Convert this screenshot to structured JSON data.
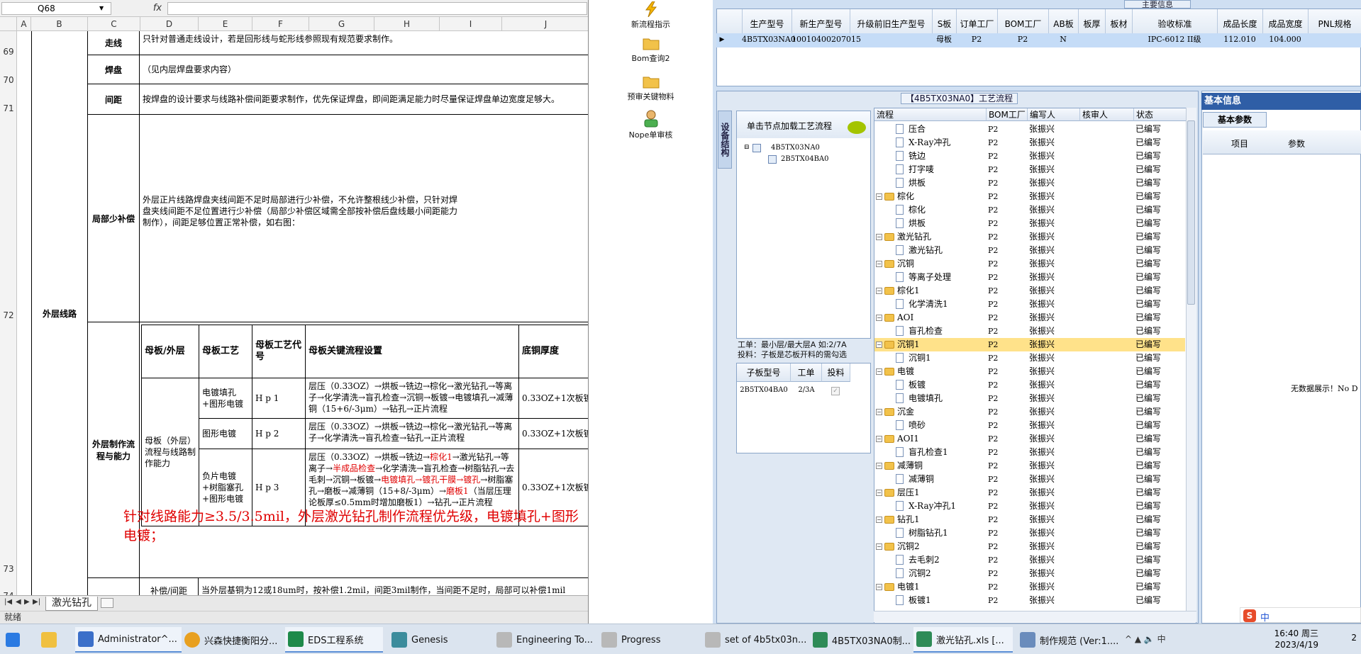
{
  "excel": {
    "name_box": "Q68",
    "fx": "fx",
    "columns": [
      "A",
      "B",
      "C",
      "D",
      "E",
      "F",
      "G",
      "H",
      "I",
      "J"
    ],
    "rows": [
      "69",
      "70",
      "71",
      "72",
      "73",
      "74"
    ],
    "labels": {
      "outer_line": "外层线路",
      "zouxian": "走线",
      "handpan": "焊盘",
      "jianju": "间距",
      "jubushao": "局部少补偿",
      "waiceng_zhizuo": "外层制作流程与能力",
      "buchang_jianju": "补偿/间距"
    },
    "texts": {
      "zouxian_text": "只针对普通走线设计，若是回形线与蛇形线参照现有规范要求制作。",
      "handpan_text": "（见内层焊盘要求内容）",
      "jianju_text": "按焊盘的设计要求与线路补偿间距要求制作，优先保证焊盘，即间距满足能力时尽量保证焊盘单边宽度足够大。",
      "jubushao_text": "外层正片线路焊盘夹线间距不足时局部进行少补偿，不允许整根线少补偿，只针对焊盘夹线间距不足位置进行少补偿（局部少补偿区域需全部按补偿后盘线最小间距能力制作），间距足够位置正常补偿，如右图：",
      "buchang_text": "当外层基铜为12或18um时，按补偿1.2mil，间距3mil制作，当间距不足时，局部可以补偿1mil"
    },
    "inner_table": {
      "headers": [
        "母板/外层",
        "母板工艺",
        "母板工艺代号",
        "母板关键流程设置",
        "底铜厚度"
      ],
      "mother_label": "母板（外层）流程与线路制作能力",
      "rows": [
        {
          "craft": "电镀填孔+图形电镀",
          "code": "H p 1",
          "flow": "层压（0.33OZ）→烘板→铣边→棕化→激光钻孔→等离子→化学清洗→盲孔检查→沉铜→板镀→电镀填孔→减薄铜（15+6/-3μm）→钻孔→正片流程",
          "copper": "0.33OZ+1次板镀"
        },
        {
          "craft": "图形电镀",
          "code": "H p 2",
          "flow": "层压（0.33OZ）→烘板→铣边→棕化→激光钻孔→等离子→化学清洗→盲孔检查→钻孔→正片流程",
          "copper": "0.33OZ+1次板镀"
        },
        {
          "craft": "负片电镀+树脂塞孔+图形电镀",
          "code": "H p 3",
          "flow_a": "层压（0.33OZ）→烘板→铣边→",
          "flow_r1": "棕化1",
          "flow_b": "→激光钻孔→等离子→",
          "flow_r2": "半成品检查",
          "flow_c": "→化学清洗→盲孔检查→树脂钻孔→去毛刺→沉铜→板镀→",
          "flow_r3": "电镀填孔→镀孔干膜→镀孔",
          "flow_d": "→树脂塞孔→磨板→减薄铜（15+8/-3μm）→",
          "flow_r4": "磨板1",
          "flow_e": "（当层压理论板厚≤0.5mm时增加磨板1）→钻孔→正片流程",
          "copper": "0.33OZ+1次板镀"
        }
      ]
    },
    "note": "针对线路能力≥3.5/3.5mil，外层激光钻孔制作流程优先级，电镀填孔+图形电镀；",
    "sheet_tab": "激光钻孔",
    "status": "就绪"
  },
  "toolbar": {
    "items": [
      {
        "label": "新流程指示",
        "icon": "lightning-icon"
      },
      {
        "label": "Bom查询2",
        "icon": "folder-icon"
      },
      {
        "label": "预审关键物料",
        "icon": "folder-icon"
      },
      {
        "label": "Nope单审核",
        "icon": "user-icon"
      }
    ]
  },
  "main_grid": {
    "title": "主要信息",
    "headers": [
      "生产型号",
      "新生产型号",
      "升级前旧生产型号",
      "S板",
      "订单工厂",
      "BOM工厂",
      "AB板",
      "板厚",
      "板材",
      "验收标准",
      "成品长度",
      "成品宽度",
      "PNL规格"
    ],
    "row": [
      "4B5TX03NA0",
      "10010400207015",
      "",
      "母板",
      "P2",
      "P2",
      "N",
      "",
      "",
      "IPC-6012 II级",
      "112.010",
      "104.000",
      ""
    ]
  },
  "process": {
    "title": "【4B5TX03NA0】工艺流程",
    "vtab": "设备结构",
    "tree_header": "单击节点加载工艺流程",
    "tree": [
      "4B5TX03NA0",
      "2B5TX04BA0"
    ],
    "work_info_1": "工单：最小层/最大层A 如:2/7A",
    "work_info_2": "投料：子板是芯板开料的需勾选",
    "sub_headers": [
      "子板型号",
      "工单",
      "投料"
    ],
    "sub_row": [
      "2B5TX04BA0",
      "2/3A"
    ],
    "flow_headers": [
      "流程",
      "BOM工厂",
      "编写人",
      "核审人",
      "状态"
    ],
    "flow_rows": [
      {
        "n": "压合",
        "l": 2,
        "t": "doc"
      },
      {
        "n": "X-Ray冲孔",
        "l": 2,
        "t": "doc"
      },
      {
        "n": "铣边",
        "l": 2,
        "t": "doc"
      },
      {
        "n": "打字唛",
        "l": 2,
        "t": "doc"
      },
      {
        "n": "烘板",
        "l": 2,
        "t": "doc"
      },
      {
        "n": "棕化",
        "l": 1,
        "t": "folder"
      },
      {
        "n": "棕化",
        "l": 2,
        "t": "doc"
      },
      {
        "n": "烘板",
        "l": 2,
        "t": "doc"
      },
      {
        "n": "激光钻孔",
        "l": 1,
        "t": "folder"
      },
      {
        "n": "激光钻孔",
        "l": 2,
        "t": "doc"
      },
      {
        "n": "沉铜",
        "l": 1,
        "t": "folder"
      },
      {
        "n": "等离子处理",
        "l": 2,
        "t": "doc"
      },
      {
        "n": "棕化1",
        "l": 1,
        "t": "folder"
      },
      {
        "n": "化学清洗1",
        "l": 2,
        "t": "doc"
      },
      {
        "n": "AOI",
        "l": 1,
        "t": "folder"
      },
      {
        "n": "盲孔检查",
        "l": 2,
        "t": "doc"
      },
      {
        "n": "沉铜1",
        "l": 1,
        "t": "folder",
        "sel": true
      },
      {
        "n": "沉铜1",
        "l": 2,
        "t": "doc"
      },
      {
        "n": "电镀",
        "l": 1,
        "t": "folder"
      },
      {
        "n": "板镀",
        "l": 2,
        "t": "doc"
      },
      {
        "n": "电镀填孔",
        "l": 2,
        "t": "doc"
      },
      {
        "n": "沉金",
        "l": 1,
        "t": "folder"
      },
      {
        "n": "喷砂",
        "l": 2,
        "t": "doc"
      },
      {
        "n": "AOI1",
        "l": 1,
        "t": "folder"
      },
      {
        "n": "盲孔检查1",
        "l": 2,
        "t": "doc"
      },
      {
        "n": "减薄铜",
        "l": 1,
        "t": "folder"
      },
      {
        "n": "减薄铜",
        "l": 2,
        "t": "doc"
      },
      {
        "n": "层压1",
        "l": 1,
        "t": "folder"
      },
      {
        "n": "X-Ray冲孔1",
        "l": 2,
        "t": "doc"
      },
      {
        "n": "钻孔1",
        "l": 1,
        "t": "folder"
      },
      {
        "n": "树脂钻孔1",
        "l": 2,
        "t": "doc"
      },
      {
        "n": "沉铜2",
        "l": 1,
        "t": "folder"
      },
      {
        "n": "去毛刺2",
        "l": 2,
        "t": "doc"
      },
      {
        "n": "沉铜2",
        "l": 2,
        "t": "doc"
      },
      {
        "n": "电镀1",
        "l": 1,
        "t": "folder"
      },
      {
        "n": "板镀1",
        "l": 2,
        "t": "doc"
      }
    ],
    "bom_value": "P2",
    "writer": "张振兴",
    "status": "已编写"
  },
  "basic": {
    "title": "基本信息",
    "tab": "基本参数",
    "headers": [
      "项目",
      "参数"
    ],
    "nodata": "无数据展示！No D"
  },
  "taskbar": {
    "items": [
      "Administrator^...",
      "兴森快捷衡阳分...",
      "EDS工程系统",
      "Genesis",
      "Engineering To...",
      "Progress",
      "set of 4b5tx03n...",
      "4B5TX03NA0制...",
      "激光钻孔.xls [...",
      "制作规范 (Ver:1...."
    ],
    "time": "16:40 周三",
    "date": "2023/4/19",
    "ime": "中",
    "notif": "2"
  }
}
